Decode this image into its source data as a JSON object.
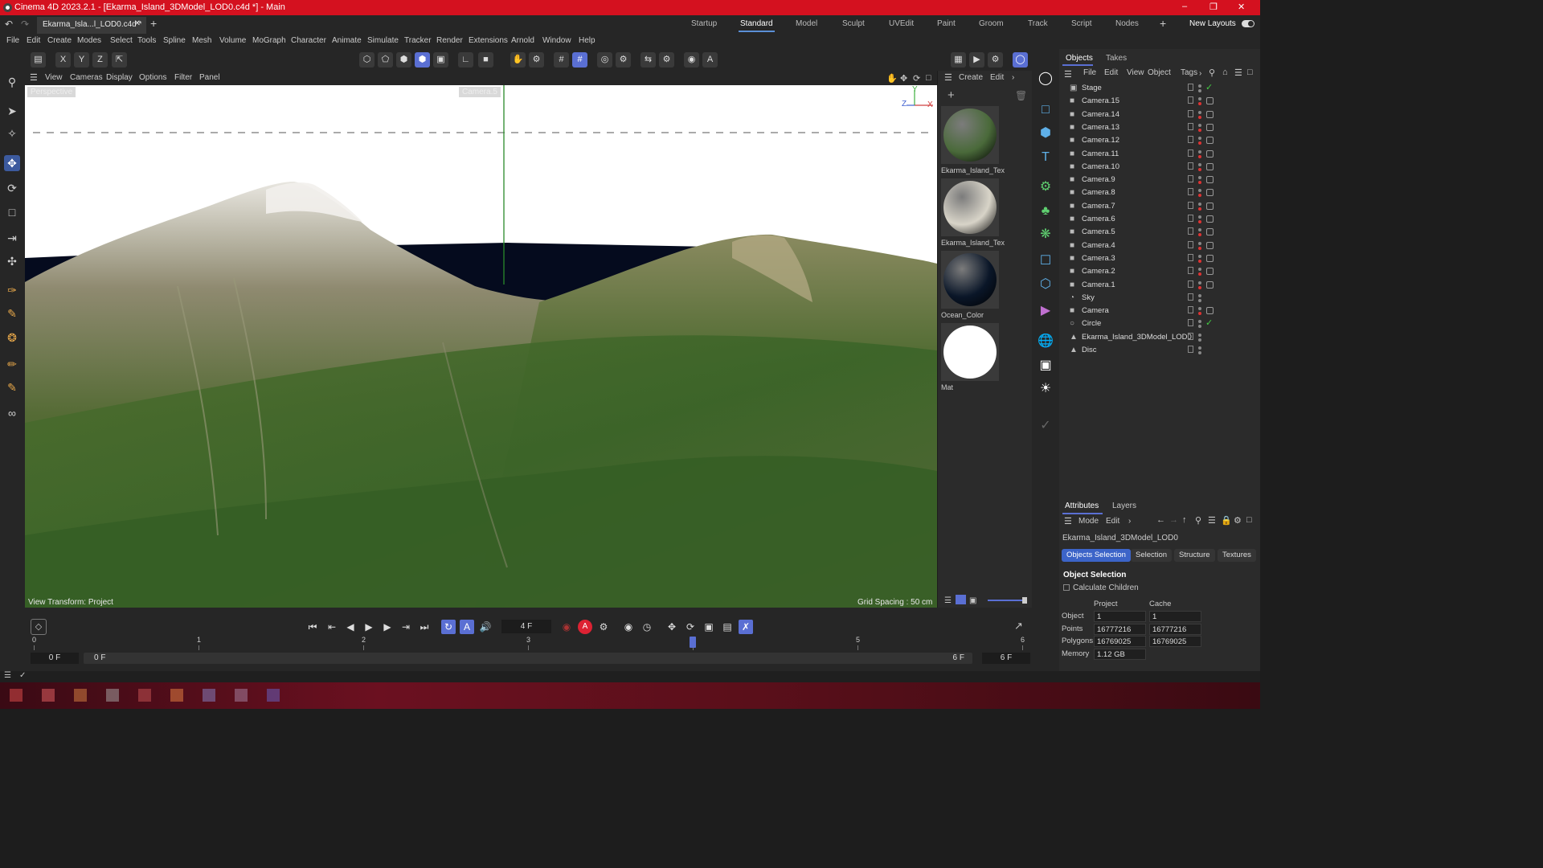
{
  "window": {
    "title": "Cinema 4D 2023.2.1 - [Ekarma_Island_3DModel_LOD0.c4d *] - Main"
  },
  "doc_tab": {
    "label": "Ekarma_Isla...l_LOD0.c4d *"
  },
  "layouts": [
    "Startup",
    "Standard",
    "Model",
    "Sculpt",
    "UVEdit",
    "Paint",
    "Groom",
    "Track",
    "Script",
    "Nodes"
  ],
  "active_layout": "Standard",
  "new_layouts_label": "New Layouts",
  "menu": [
    "File",
    "Edit",
    "Create",
    "Modes",
    "Select",
    "Tools",
    "Spline",
    "Mesh",
    "Volume",
    "MoGraph",
    "Character",
    "Animate",
    "Simulate",
    "Tracker",
    "Render",
    "Extensions",
    "Arnold",
    "Window",
    "Help"
  ],
  "axis_buttons": [
    "X",
    "Y",
    "Z"
  ],
  "viewport": {
    "menu": [
      "View",
      "Cameras",
      "Display",
      "Options",
      "Filter",
      "Panel"
    ],
    "camera_name": "Perspective",
    "default_camera": "Camera.5",
    "view_transform": "View Transform: Project",
    "grid_spacing": "Grid Spacing : 50 cm",
    "axis_labels": {
      "z": "Z",
      "y": "Y",
      "x": "X"
    }
  },
  "material_panel": {
    "menu": [
      "Create",
      "Edit"
    ],
    "materials": [
      {
        "name": "Ekarma_Island_Tex",
        "color": "#4a6a3a"
      },
      {
        "name": "Ekarma_Island_Tex",
        "color": "#d8d4c8"
      },
      {
        "name": "Ocean_Color",
        "color": "#0a1628"
      },
      {
        "name": "Mat",
        "color": "#ffffff"
      }
    ]
  },
  "objects_panel": {
    "tabs": [
      "Objects",
      "Takes"
    ],
    "menu": [
      "File",
      "Edit",
      "View",
      "Object",
      "Tags"
    ],
    "items": [
      {
        "name": "Stage",
        "icon": "stage-icon",
        "check": true
      },
      {
        "name": "Camera.15",
        "icon": "camera-icon"
      },
      {
        "name": "Camera.14",
        "icon": "camera-icon"
      },
      {
        "name": "Camera.13",
        "icon": "camera-icon"
      },
      {
        "name": "Camera.12",
        "icon": "camera-icon"
      },
      {
        "name": "Camera.11",
        "icon": "camera-icon"
      },
      {
        "name": "Camera.10",
        "icon": "camera-icon"
      },
      {
        "name": "Camera.9",
        "icon": "camera-icon"
      },
      {
        "name": "Camera.8",
        "icon": "camera-icon"
      },
      {
        "name": "Camera.7",
        "icon": "camera-icon"
      },
      {
        "name": "Camera.6",
        "icon": "camera-icon"
      },
      {
        "name": "Camera.5",
        "icon": "camera-icon"
      },
      {
        "name": "Camera.4",
        "icon": "camera-icon"
      },
      {
        "name": "Camera.3",
        "icon": "camera-icon"
      },
      {
        "name": "Camera.2",
        "icon": "camera-icon"
      },
      {
        "name": "Camera.1",
        "icon": "camera-icon"
      },
      {
        "name": "Sky",
        "icon": "sky-icon"
      },
      {
        "name": "Camera",
        "icon": "camera-icon"
      },
      {
        "name": "Circle",
        "icon": "circle-icon",
        "check": true
      },
      {
        "name": "Ekarma_Island_3DModel_LOD0",
        "icon": "polygon-icon"
      },
      {
        "name": "Disc",
        "icon": "polygon-icon"
      }
    ]
  },
  "attributes_panel": {
    "tabs": [
      "Attributes",
      "Layers"
    ],
    "menu": [
      "Mode",
      "Edit"
    ],
    "object_name": "Ekarma_Island_3DModel_LOD0",
    "subtabs": [
      "Objects Selection",
      "Selection",
      "Structure",
      "Textures"
    ],
    "active_subtab": "Objects Selection",
    "section_title": "Object Selection",
    "calc_children": "Calculate Children",
    "col_headers": [
      "Project",
      "Cache"
    ],
    "rows": [
      {
        "label": "Object",
        "project": "1",
        "cache": "1"
      },
      {
        "label": "Points",
        "project": "16777216",
        "cache": "16777216"
      },
      {
        "label": "Polygons",
        "project": "16769025",
        "cache": "16769025"
      },
      {
        "label": "Memory",
        "project": "1.12 GB",
        "cache": ""
      }
    ]
  },
  "timeline": {
    "current_frame": "4 F",
    "ticks": [
      "0",
      "1",
      "2",
      "3",
      "4",
      "5",
      "6"
    ],
    "playhead_frame": 4,
    "max_frame": 6,
    "start_field": "0 F",
    "range_start": "0 F",
    "range_end": "6 F",
    "end_field": "6 F"
  },
  "colors": {
    "accent": "#5a6fd3",
    "titlebar": "#d4111f",
    "selection_blue": "#3c64c8"
  }
}
